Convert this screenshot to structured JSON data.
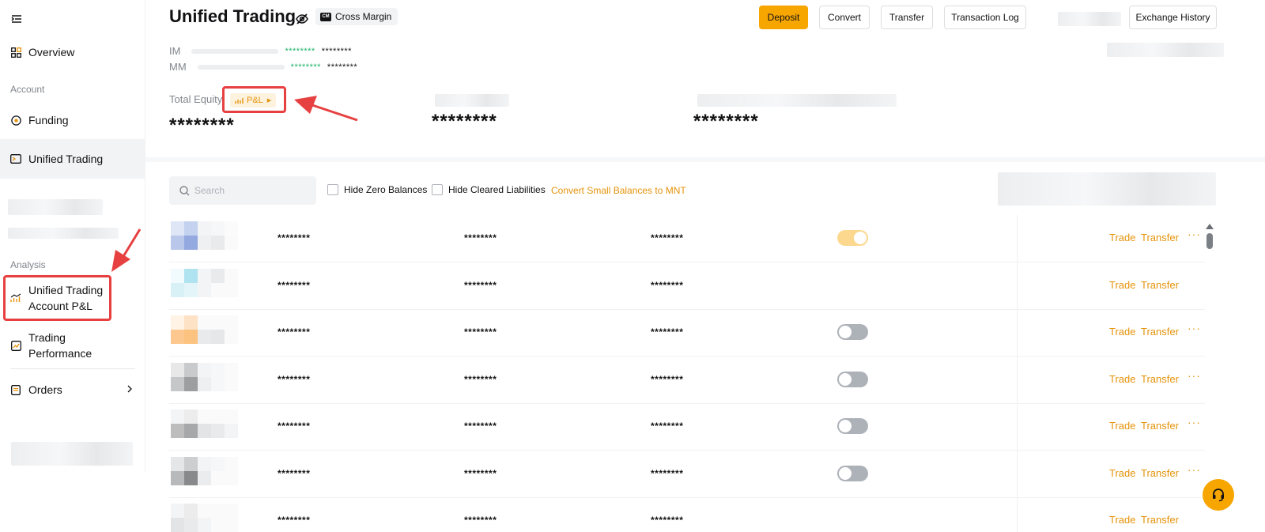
{
  "sidebar": {
    "overview": "Overview",
    "section_account": "Account",
    "funding": "Funding",
    "unified_trading": "Unified Trading",
    "section_analysis": "Analysis",
    "pnl_line1": "Unified Trading",
    "pnl_line2": "Account P&L",
    "perf_line1": "Trading",
    "perf_line2": "Performance",
    "orders": "Orders"
  },
  "header": {
    "title": "Unified Trading",
    "mode_badge": "Cross Margin",
    "buttons": {
      "deposit": "Deposit",
      "convert": "Convert",
      "transfer": "Transfer",
      "transaction_log": "Transaction Log",
      "exchange_history": "Exchange History"
    }
  },
  "margin": {
    "im_label": "IM",
    "mm_label": "MM",
    "masked_pct": "********",
    "masked_val": "********"
  },
  "equity": {
    "label": "Total Equity",
    "pnl_chip": "P&L",
    "value_1": "********",
    "value_2": "********",
    "value_3": "********"
  },
  "toolbar": {
    "search_placeholder": "Search",
    "hide_zero": "Hide Zero Balances",
    "hide_cleared": "Hide Cleared Liabilities",
    "convert_small": "Convert Small Balances to MNT"
  },
  "table": {
    "masked": "********",
    "trade": "Trade",
    "transfer": "Transfer",
    "more": "···",
    "rows": [
      {
        "toggle": "on",
        "more": true
      },
      {
        "toggle": "none",
        "more": false
      },
      {
        "toggle": "off",
        "more": true
      },
      {
        "toggle": "off",
        "more": true
      },
      {
        "toggle": "off",
        "more": true
      },
      {
        "toggle": "off",
        "more": true
      },
      {
        "toggle": "none",
        "more": false
      }
    ]
  },
  "colors": {
    "accent": "#f7a600",
    "link": "#e5930b",
    "positive": "#20b26c",
    "annotation": "#e74040"
  }
}
